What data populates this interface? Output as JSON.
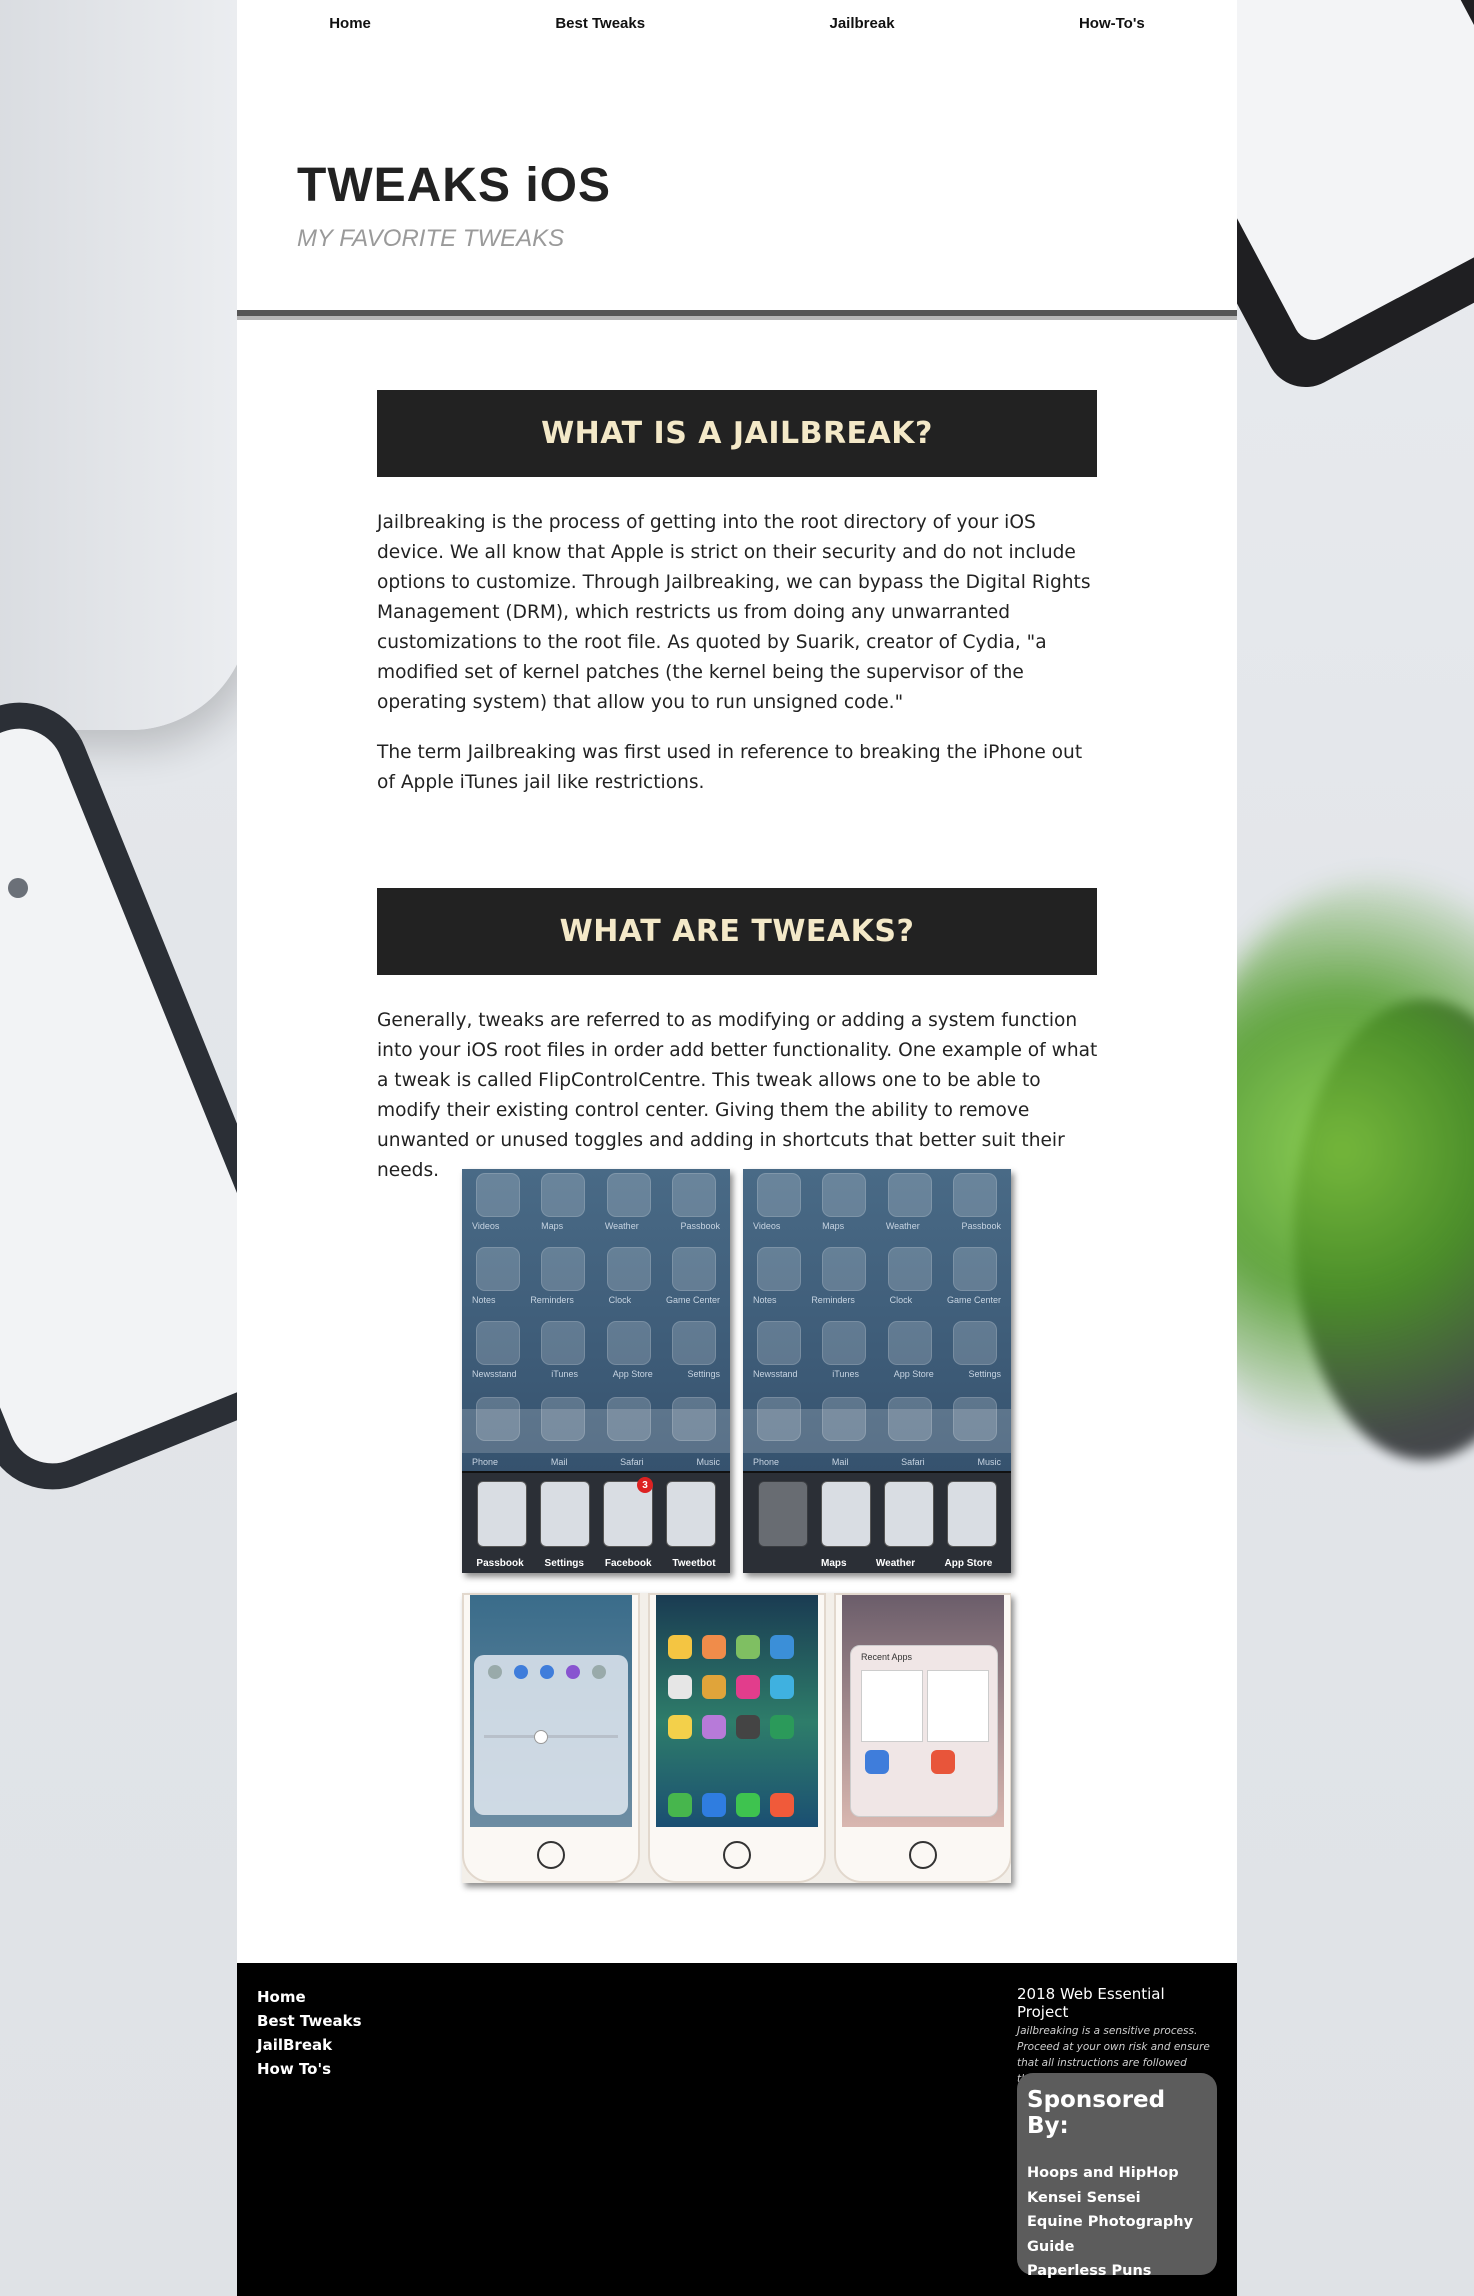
{
  "nav": {
    "items": [
      {
        "label": "Home"
      },
      {
        "label": "Best Tweaks"
      },
      {
        "label": "Jailbreak"
      },
      {
        "label": "How-To's"
      }
    ]
  },
  "header": {
    "title": "TWEAKS iOS",
    "tagline": "MY FAVORITE TWEAKS"
  },
  "sections": [
    {
      "heading": "WHAT IS A JAILBREAK?",
      "paragraphs": [
        "Jailbreaking is the process of getting into the root directory of your iOS device. We all know that Apple is strict on their security and do not include options to customize. Through Jailbreaking, we can bypass the Digital Rights Management (DRM), which restricts us from doing any unwarranted customizations to the root file. As quoted by Suarik, creator of Cydia, \"a modified set of kernel patches (the kernel being the supervisor of the operating system) that allow you to run unsigned code.\"",
        "The term Jailbreaking was first used in reference to breaking the iPhone out of Apple iTunes jail like restrictions."
      ]
    },
    {
      "heading": "WHAT ARE TWEAKS?",
      "paragraphs": [
        "Generally, tweaks are referred to as modifying or adding a system function into your iOS root files in order add better functionality. One example of what a tweak is called FlipControlCentre. This tweak allows one to be able to modify their existing control center. Giving them the ability to remove unwanted or unused toggles and adding in shortcuts that better suit their needs."
      ]
    }
  ],
  "illustration": {
    "ios6_app_rows": [
      [
        "Videos",
        "Maps",
        "Weather",
        "Passbook"
      ],
      [
        "Notes",
        "Reminders",
        "Clock",
        "Game Center"
      ],
      [
        "Newsstand",
        "iTunes",
        "App Store",
        "Settings"
      ]
    ],
    "ios6_dock": [
      "Phone",
      "Mail",
      "Safari",
      "Music"
    ],
    "switcher_left": [
      "Passbook",
      "Settings",
      "Facebook",
      "Tweetbot"
    ],
    "switcher_right": [
      "",
      "Maps",
      "Weather",
      "App Store"
    ],
    "facebook_badge": "3",
    "recent_apps_label": "Recent Apps"
  },
  "footer": {
    "nav": [
      {
        "label": "Home"
      },
      {
        "label": "Best Tweaks"
      },
      {
        "label": "JailBreak"
      },
      {
        "label": "How To's"
      }
    ],
    "project": "2018 Web Essential Project",
    "disclaimer": "Jailbreaking is a sensitive process. Proceed at your own risk and ensure that all instructions are followed through.",
    "sponsor_title": "Sponsored By:",
    "sponsors": [
      {
        "label": "Hoops and HipHop"
      },
      {
        "label": "Kensei Sensei"
      },
      {
        "label": "Equine Photography Guide"
      },
      {
        "label": "Paperless Puns"
      }
    ]
  },
  "colors": {
    "section_head_bg": "#222222",
    "section_head_text": "#f4e9c8",
    "footer_bg": "#000000",
    "sponsor_bg": "#5c5c5c"
  }
}
